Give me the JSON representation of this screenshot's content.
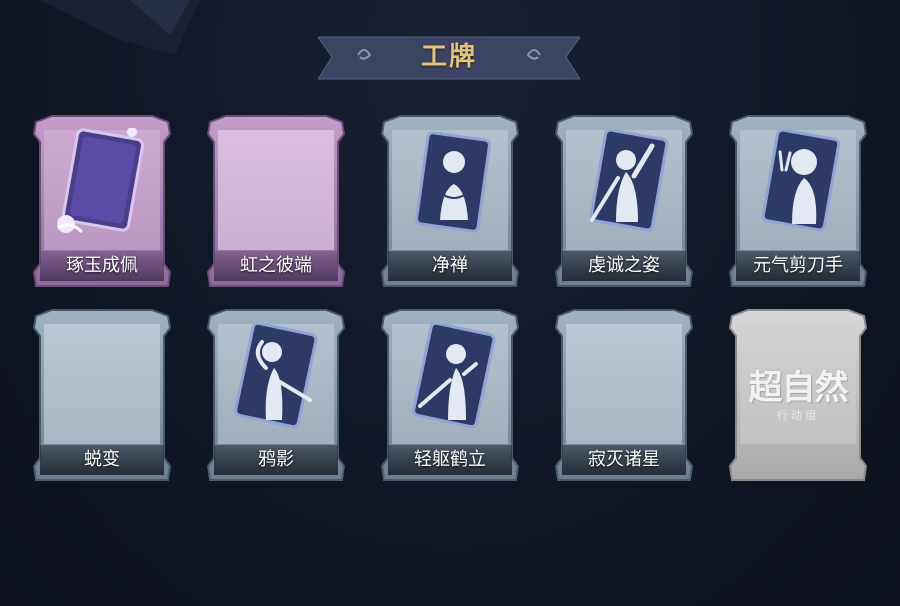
{
  "header": {
    "title": "工牌"
  },
  "cards": [
    {
      "label": "琢玉成佩",
      "variant": "purple",
      "icon": "ornate-card-icon"
    },
    {
      "label": "虹之彼端",
      "variant": "purple",
      "icon": "none"
    },
    {
      "label": "净禅",
      "variant": "blue",
      "icon": "meditation-silhouette-card-icon"
    },
    {
      "label": "虔诚之姿",
      "variant": "blue",
      "icon": "raised-arm-silhouette-card-icon"
    },
    {
      "label": "元气剪刀手",
      "variant": "blue",
      "icon": "peace-sign-silhouette-card-icon"
    },
    {
      "label": "蜕变",
      "variant": "blue",
      "icon": "none"
    },
    {
      "label": "鸦影",
      "variant": "blue",
      "icon": "pose-silhouette-card-icon"
    },
    {
      "label": "轻躯鹤立",
      "variant": "blue",
      "icon": "crane-pose-silhouette-card-icon"
    },
    {
      "label": "寂灭诸星",
      "variant": "blue",
      "icon": "none"
    },
    {
      "label": "",
      "variant": "silver",
      "icon": "event-logo-icon"
    }
  ],
  "event_logo": {
    "main": "超自然",
    "sub": "行动组"
  },
  "colors": {
    "title_gold": "#e7c27a",
    "banner": "#3c4463",
    "purple_frame": "#a176a8",
    "blue_frame": "#6f8394",
    "silver_frame": "#bdbdbd",
    "background": "#0e1420"
  }
}
